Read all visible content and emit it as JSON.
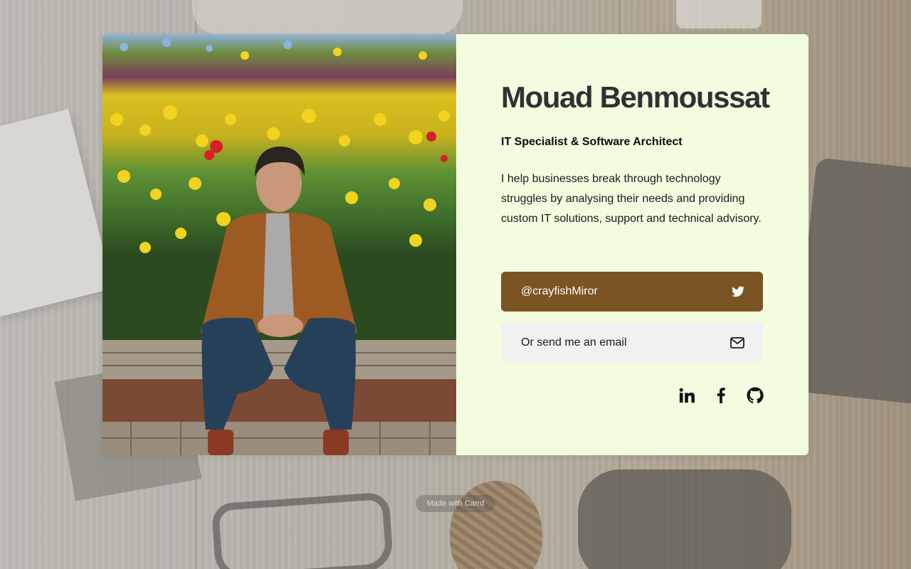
{
  "profile": {
    "name": "Mouad Benmoussat",
    "role": "IT Specialist & Software Architect",
    "bio": "I help businesses break through technology struggles by analysing their needs and providing custom IT solutions, support and technical advisory."
  },
  "buttons": {
    "twitter_label": "@crayfishMiror",
    "email_label": "Or send me an email"
  },
  "socials": [
    {
      "name": "linkedin",
      "icon": "linkedin-icon"
    },
    {
      "name": "facebook",
      "icon": "facebook-icon"
    },
    {
      "name": "github",
      "icon": "github-icon"
    }
  ],
  "footer": {
    "made_with": "Made with Carrd"
  },
  "colors": {
    "panel_bg": "#f2fde0",
    "twitter_button": "#7a5523",
    "email_button": "#f1f1f1",
    "name_text": "#2f3234"
  }
}
